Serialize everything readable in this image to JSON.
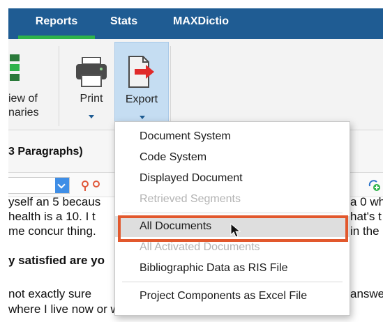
{
  "tabs": [
    {
      "label": "Reports",
      "active": true
    },
    {
      "label": "Stats",
      "active": false
    },
    {
      "label": "MAXDictio",
      "active": false
    }
  ],
  "ribbon": {
    "overview": {
      "line1": "iew of",
      "line2": "naries",
      "icon": "overview-icon"
    },
    "print": {
      "label": "Print",
      "icon": "printer-icon"
    },
    "export": {
      "label": "Export",
      "icon": "export-icon",
      "active": true
    }
  },
  "para_header": "3 Paragraphs)",
  "document_lines": [
    "yself an 5 becaus",
    "health is a 10. I t",
    "me concur thing.",
    "y satisfied are yo",
    "not exactly sure",
    "where I live now or where I use to live. I would rate my life s"
  ],
  "document_right_fragments": [
    "a 0 wh",
    "hat's t",
    "in the",
    "answe"
  ],
  "menu": {
    "items": [
      {
        "label": "Document System",
        "enabled": true
      },
      {
        "label": "Code System",
        "enabled": true
      },
      {
        "label": "Displayed Document",
        "enabled": true
      },
      {
        "label": "Retrieved Segments",
        "enabled": false
      },
      {
        "label": "All Documents",
        "enabled": true,
        "highlighted": true
      },
      {
        "label": "All Activated Documents",
        "enabled": false
      },
      {
        "label": "Bibliographic Data as RIS File",
        "enabled": true
      },
      {
        "label": "Project Components as Excel File",
        "enabled": true
      }
    ]
  },
  "colors": {
    "tabbar": "#1f5c93",
    "tab_indicator": "#2eb34a",
    "highlight_border": "#e2582d",
    "export_red": "#e02a2a"
  }
}
